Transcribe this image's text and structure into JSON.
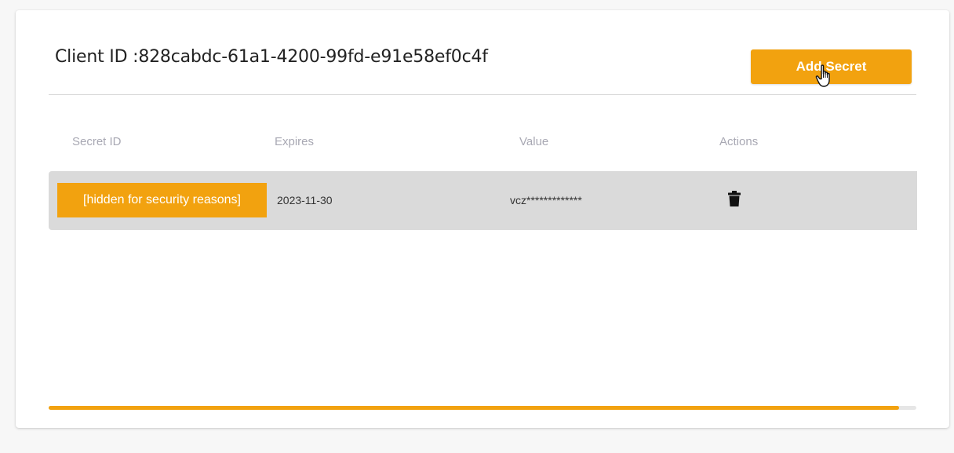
{
  "header": {
    "title": "Client ID :828cabdc-61a1-4200-99fd-e91e58ef0c4f",
    "add_secret_label": "Add Secret"
  },
  "table": {
    "columns": [
      "Secret ID",
      "Expires",
      "Value",
      "Actions"
    ],
    "rows": [
      {
        "secret_id": "[hidden for security reasons]",
        "expires": "2023-11-30",
        "value": "vcz*************",
        "action_icon": "trash-icon"
      }
    ]
  },
  "progress": {
    "fraction": 0.98
  },
  "colors": {
    "accent": "#f2a20f",
    "row_bg": "#dadada",
    "header_text": "#a8a8b3"
  }
}
